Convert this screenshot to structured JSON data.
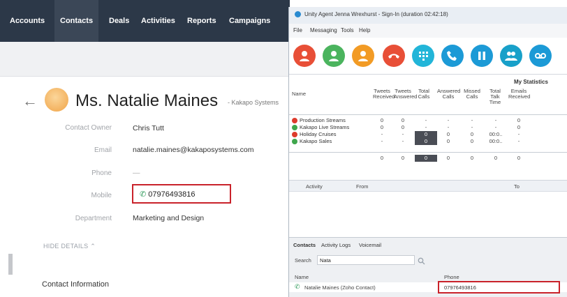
{
  "crm": {
    "nav": [
      "Accounts",
      "Contacts",
      "Deals",
      "Activities",
      "Reports",
      "Campaigns"
    ],
    "active_tab": "Contacts",
    "contact": {
      "name": "Ms. Natalie Maines",
      "company": "- Kakapo Systems",
      "fields": [
        {
          "label": "Contact Owner",
          "value": "Chris Tutt"
        },
        {
          "label": "Email",
          "value": "natalie.maines@kakaposystems.com"
        },
        {
          "label": "Phone",
          "value": "—"
        },
        {
          "label": "Mobile",
          "value": "07976493816"
        },
        {
          "label": "Department",
          "value": "Marketing and Design"
        }
      ]
    },
    "hide_details": "HIDE DETAILS",
    "section_title": "Contact Information"
  },
  "unity": {
    "title": "Unity Agent Jenna Wrexhurst - Sign-In (duration 02:42:18)",
    "menu": [
      "File",
      "Messaging",
      "Tools",
      "Help"
    ],
    "toolbar_icons": [
      "agent-red-icon",
      "agent-green-icon",
      "agent-orange-icon",
      "hangup-icon",
      "dialpad-icon",
      "call-icon",
      "pause-icon",
      "conference-icon",
      "voicemail-icon"
    ],
    "stats": {
      "title": "My Statistics",
      "columns": [
        "Name",
        "Tweets Received",
        "Tweets Answered",
        "Total Calls",
        "Answered Calls",
        "Missed Calls",
        "Total Talk Time",
        "Emails Received"
      ],
      "rows": [
        {
          "status": "red",
          "name": "Production Streams",
          "cells": [
            "0",
            "0",
            "-",
            "-",
            "-",
            "-",
            "0"
          ]
        },
        {
          "status": "green",
          "name": "Kakapo Live Streams",
          "cells": [
            "0",
            "0",
            "-",
            "-",
            "-",
            "-",
            "0"
          ]
        },
        {
          "status": "red",
          "name": "Holiday Cruises",
          "cells": [
            "-",
            "-",
            "0",
            "0",
            "0",
            "00:0..",
            "-"
          ]
        },
        {
          "status": "green",
          "name": "Kakapo Sales",
          "cells": [
            "-",
            "-",
            "0",
            "0",
            "0",
            "00:0..",
            "-"
          ]
        }
      ],
      "totals": [
        "0",
        "0",
        "0",
        "0",
        "0",
        "0",
        "0"
      ]
    },
    "activity": {
      "columns": [
        "Activity",
        "From",
        "To"
      ]
    },
    "lower": {
      "tabs": [
        "Contacts",
        "Activity Logs",
        "Voicemail"
      ],
      "active_tab": "Contacts",
      "search_label": "Search",
      "search_value": "Nata",
      "result_columns": [
        "Name",
        "Phone"
      ],
      "result": {
        "name": "Natalie Maines (Zoho Contact)",
        "phone": "07976493816"
      }
    }
  }
}
